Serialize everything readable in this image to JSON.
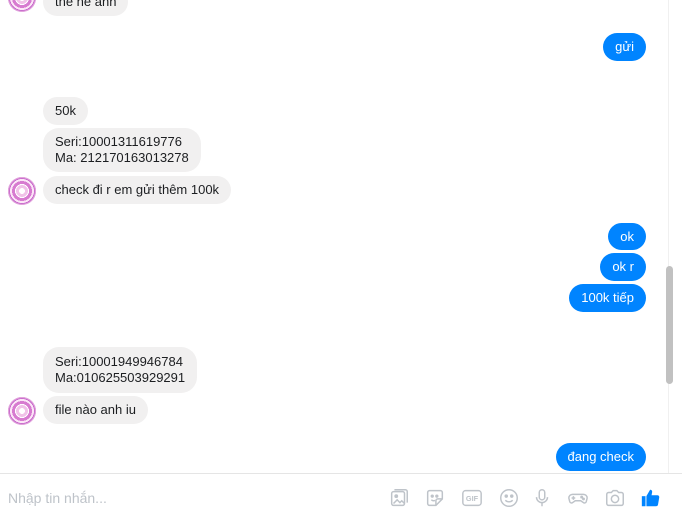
{
  "messages": [
    {
      "side": "in",
      "text": "thẻ hẻ anh"
    },
    {
      "side": "out",
      "text": "gửi"
    },
    {
      "side": "in",
      "text": "50k"
    },
    {
      "side": "in",
      "text": "Seri:10001311619776\nMa: 212170163013278"
    },
    {
      "side": "in",
      "text": "check đi r em gửi thêm 100k"
    },
    {
      "side": "out",
      "text": "ok"
    },
    {
      "side": "out",
      "text": "ok r"
    },
    {
      "side": "out",
      "text": "100k tiếp"
    },
    {
      "side": "in",
      "text": "Seri:10001949946784\nMa:010625503929291"
    },
    {
      "side": "in",
      "text": "file nào anh iu"
    },
    {
      "side": "out",
      "text": "đang check"
    }
  ],
  "composer": {
    "placeholder": "Nhập tin nhắn...",
    "tools": [
      "sticker-icon",
      "emoji-sticker-icon",
      "gif-icon",
      "emoji-icon",
      "microphone-icon",
      "game-controller-icon",
      "camera-icon",
      "like-icon"
    ]
  },
  "colors": {
    "outgoing": "#0084ff",
    "incoming": "#f1f0f0",
    "icon": "#bec3c9",
    "like": "#0084ff"
  }
}
